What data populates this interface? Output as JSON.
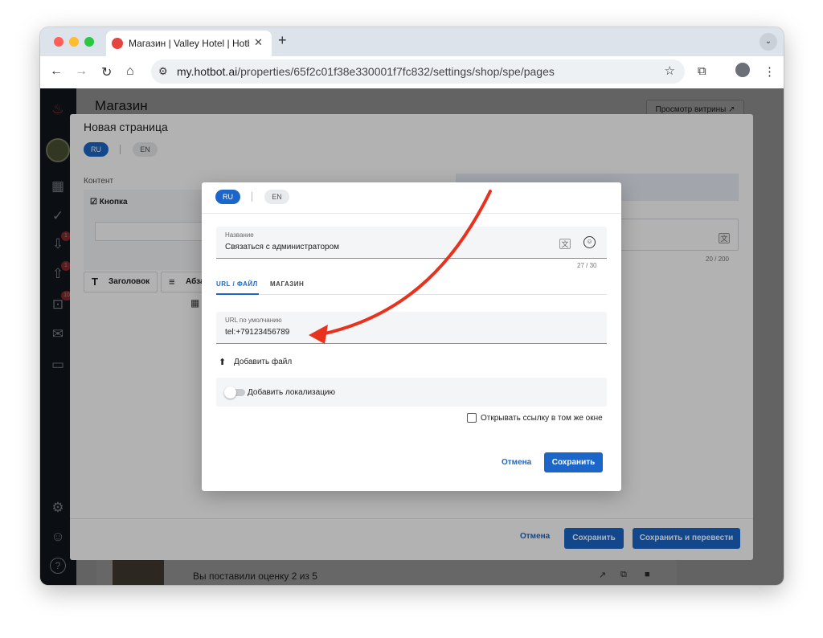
{
  "browser": {
    "tab_title": "Магазин | Valley Hotel | Hotbot",
    "tab_close": "✕",
    "new_tab": "+",
    "tab_menu": "⌄",
    "url_domain": "my.hotbot.ai",
    "url_path": "/properties/65f2c01f38e330001f7fc832/settings/shop/spe/pages",
    "back": "←",
    "forward": "→",
    "reload": "↻",
    "home": "⌂",
    "site_info": "⚙",
    "bookmark": "☆",
    "extensions": "⧉",
    "menu": "⋮"
  },
  "sidebar": {
    "icons": [
      "flame-logo-icon",
      "property-avatar-icon",
      "analytics-icon",
      "tasks-icon",
      "inbox-download-icon",
      "inbox-upload-icon",
      "shop-cart-icon",
      "mail-icon",
      "chat-icon",
      "settings-icon",
      "profile-icon",
      "help-icon"
    ],
    "badges": [
      "1",
      "1",
      "10"
    ],
    "glyphs": {
      "flame": "♨",
      "analytics": "▦",
      "tasks": "✓",
      "download": "⇩",
      "upload": "⇧",
      "cart": "⊡",
      "mail": "✉",
      "chat": "▭",
      "settings": "⚙",
      "profile": "☺",
      "help": "?"
    }
  },
  "background_page": {
    "title": "Магазин",
    "preview_button": "Просмотр витрины ↗",
    "row_text": "Вы поставили оценку 2 из 5",
    "row_actions": [
      "↗",
      "⧉",
      "■"
    ]
  },
  "outer_dialog": {
    "title": "Новая страница",
    "languages": [
      "RU",
      "EN"
    ],
    "content_label": "Контент",
    "card_label": "☑ Кнопка",
    "counter": "20 / 200",
    "translate_glyph": "文",
    "tools": [
      {
        "glyph": "T",
        "label": "Заголовок"
      },
      {
        "glyph": "≡",
        "label": "Абза"
      }
    ],
    "calendar_glyph": "▦",
    "cancel": "Отмена",
    "save": "Сохранить",
    "save_translate": "Сохранить и перевести"
  },
  "inner_dialog": {
    "languages": [
      "RU",
      "EN"
    ],
    "name_field": {
      "label": "Название",
      "value": "Связаться с администратором"
    },
    "translate_glyph": "文",
    "emoji_glyph": "☺",
    "counter": "27 / 30",
    "tabs": [
      "URL / ФАЙЛ",
      "МАГАЗИН"
    ],
    "url_field": {
      "label": "URL по умолчанию",
      "value": "tel:+79123456789"
    },
    "upload_glyph": "⬆",
    "upload_label": "Добавить файл",
    "localization_toggle": {
      "label": "Добавить локализацию",
      "on": false
    },
    "same_window_checkbox": {
      "label": "Открывать ссылку в том же окне",
      "checked": false
    },
    "cancel": "Отмена",
    "save": "Сохранить"
  },
  "annotation": {
    "arrow_color": "#e8321e"
  },
  "colors": {
    "primary": "#1c66c9",
    "sidebar": "#1e2530",
    "badge": "#e04848"
  }
}
